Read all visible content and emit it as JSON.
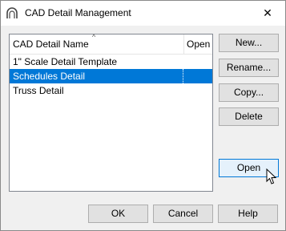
{
  "window": {
    "title": "CAD Detail Management",
    "close_glyph": "✕"
  },
  "list": {
    "columns": [
      "CAD Detail Name",
      "Open"
    ],
    "sort_indicator": "^",
    "rows": [
      {
        "name": "1\" Scale Detail Template",
        "open": "",
        "selected": false
      },
      {
        "name": "Schedules Detail",
        "open": "",
        "selected": true
      },
      {
        "name": "Truss Detail",
        "open": "",
        "selected": false
      }
    ]
  },
  "side_buttons": {
    "new": "New...",
    "rename": "Rename...",
    "copy": "Copy...",
    "delete": "Delete",
    "open": "Open"
  },
  "footer_buttons": {
    "ok": "OK",
    "cancel": "Cancel",
    "help": "Help"
  },
  "colors": {
    "selection": "#0078d7",
    "focus_border": "#0078d7"
  },
  "icons": {
    "app": "arch-logo-icon",
    "close": "close-icon",
    "cursor": "mouse-pointer-icon"
  }
}
